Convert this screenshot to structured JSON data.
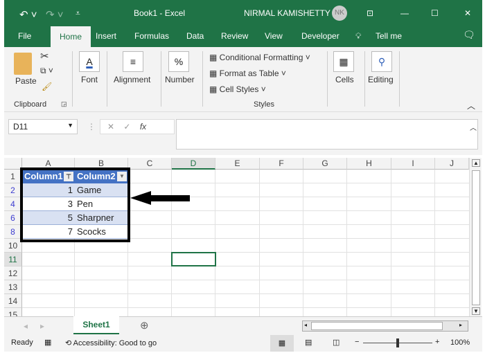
{
  "titlebar": {
    "title": "Book1  -  Excel",
    "user": "NIRMAL KAMISHETTY",
    "initials": "NK"
  },
  "tabs": [
    "File",
    "Home",
    "Insert",
    "Formulas",
    "Data",
    "Review",
    "View",
    "Developer",
    "Tell me"
  ],
  "ribbon": {
    "paste": "Paste",
    "clipboard": "Clipboard",
    "font": "Font",
    "alignment": "Alignment",
    "number": "Number",
    "conditional": "Conditional Formatting",
    "format_table": "Format as Table",
    "cell_styles": "Cell Styles",
    "styles": "Styles",
    "cells": "Cells",
    "editing": "Editing",
    "font_icon": "A",
    "number_icon": "%"
  },
  "formula": {
    "name_box": "D11",
    "fx": "fx",
    "value": ""
  },
  "columns": [
    "A",
    "B",
    "C",
    "D",
    "E",
    "F",
    "G",
    "H",
    "I",
    "J"
  ],
  "rows": [
    "1",
    "2",
    "4",
    "6",
    "8",
    "10",
    "11",
    "12",
    "13",
    "14",
    "15"
  ],
  "table": {
    "headers": [
      "Column1",
      "Column2"
    ],
    "data": [
      [
        "1",
        "Game"
      ],
      [
        "3",
        "Pen"
      ],
      [
        "5",
        "Sharpner"
      ],
      [
        "7",
        "Scocks"
      ]
    ]
  },
  "sheet_tab": "Sheet1",
  "status": {
    "ready": "Ready",
    "accessibility": "Accessibility: Good to go",
    "zoom": "100%"
  },
  "colors": {
    "brand": "#1f7346",
    "table_header": "#4472c4",
    "band": "#d9e1f2"
  }
}
